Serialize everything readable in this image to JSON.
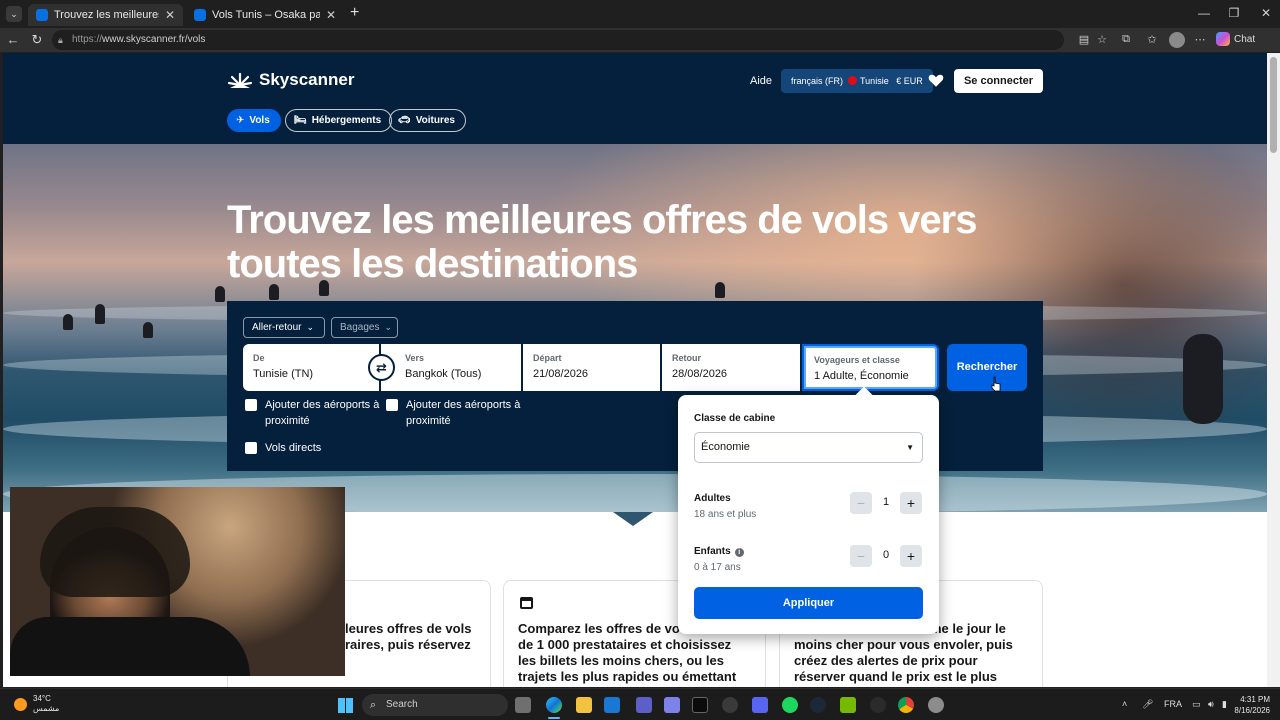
{
  "browser": {
    "tabs": [
      {
        "title": "Trouvez les meilleures offres de vo",
        "active": true
      },
      {
        "title": "Vols Tunis – Osaka pas chers sur S",
        "active": false
      }
    ],
    "new_tab": "+",
    "url_prefix": "https://",
    "url": "www.skyscanner.fr/vols",
    "copilot_label": "Chat",
    "window_buttons": [
      "—",
      "❐",
      "✕"
    ]
  },
  "header": {
    "brand": "Skyscanner",
    "help": "Aide",
    "locale": {
      "language": "français (FR)",
      "country": "Tunisie",
      "currency": "€ EUR"
    },
    "login": "Se connecter",
    "nav": [
      {
        "label": "Vols",
        "icon": "plane-icon",
        "active": true
      },
      {
        "label": "Hébergements",
        "icon": "bed-icon",
        "active": false
      },
      {
        "label": "Voitures",
        "icon": "car-icon",
        "active": false
      }
    ]
  },
  "hero": {
    "headline_line1": "Trouvez les meilleures offres de vols vers",
    "headline_line2": "toutes les destinations"
  },
  "search": {
    "trip_type": "Aller-retour",
    "baggage": "Bagages",
    "from": {
      "label": "De",
      "value": "Tunisie (TN)"
    },
    "to": {
      "label": "Vers",
      "value": "Bangkok (Tous)"
    },
    "depart": {
      "label": "Départ",
      "value": "21/08/2026"
    },
    "return": {
      "label": "Retour",
      "value": "28/08/2026"
    },
    "travellers": {
      "label": "Voyageurs et classe",
      "value": "1 Adulte, Économie"
    },
    "search_button": "Rechercher",
    "nearby_from_1": "Ajouter des aéroports à",
    "nearby_from_2": "proximité",
    "nearby_to_1": "Ajouter des aéroports à",
    "nearby_to_2": "proximité",
    "direct": "Vols directs"
  },
  "popup": {
    "cabin_title": "Classe de cabine",
    "cabin_value": "Économie",
    "adults_title": "Adultes",
    "adults_sub": "18 ans et plus",
    "adults_count": "1",
    "children_title": "Enfants",
    "children_sub": "0 à 17 ans",
    "children_count": "0",
    "apply": "Appliquer"
  },
  "cards": {
    "card1_l1": "leures offres de vols",
    "card1_l2": "raires, puis réservez",
    "card2_l1": "Comparez les offres de vo",
    "card2_l2": "de 1 000 prestataires et choisissez",
    "card2_l3": "les billets les moins chers, ou les",
    "card2_l4": "trajets les plus rapides ou émettant",
    "card3_l1": "me le jour le",
    "card3_l2": "moins cher pour vous envoler, puis",
    "card3_l3": "créez des alertes de prix pour",
    "card3_l4": "réserver quand le prix est le plus"
  },
  "taskbar": {
    "weather_temp": "34°C",
    "weather_desc": "مشمس",
    "search_placeholder": "Search",
    "lang": "FRA",
    "time": "4:31 PM",
    "date": "8/16/2026"
  },
  "colors": {
    "brand_dark": "#05203c",
    "accent": "#0062e3"
  }
}
